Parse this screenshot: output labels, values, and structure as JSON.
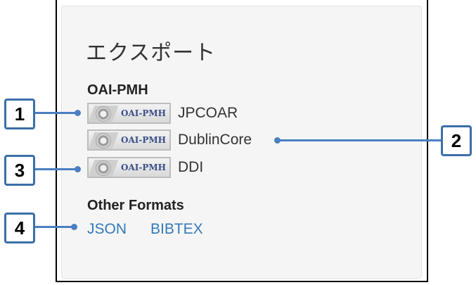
{
  "panel": {
    "heading": "エクスポート",
    "oai_section_label": "OAI-PMH",
    "oai_badge_text": "OAI-PMH",
    "oai_formats": [
      {
        "label": "JPCOAR"
      },
      {
        "label": "DublinCore"
      },
      {
        "label": "DDI"
      }
    ],
    "other_section_label": "Other Formats",
    "other_formats": [
      {
        "label": "JSON"
      },
      {
        "label": "BIBTEX"
      }
    ]
  },
  "callouts": [
    "1",
    "2",
    "3",
    "4"
  ],
  "colors": {
    "link": "#337ab7",
    "callout": "#4a7fc1",
    "panel_bg": "#f5f5f5"
  }
}
